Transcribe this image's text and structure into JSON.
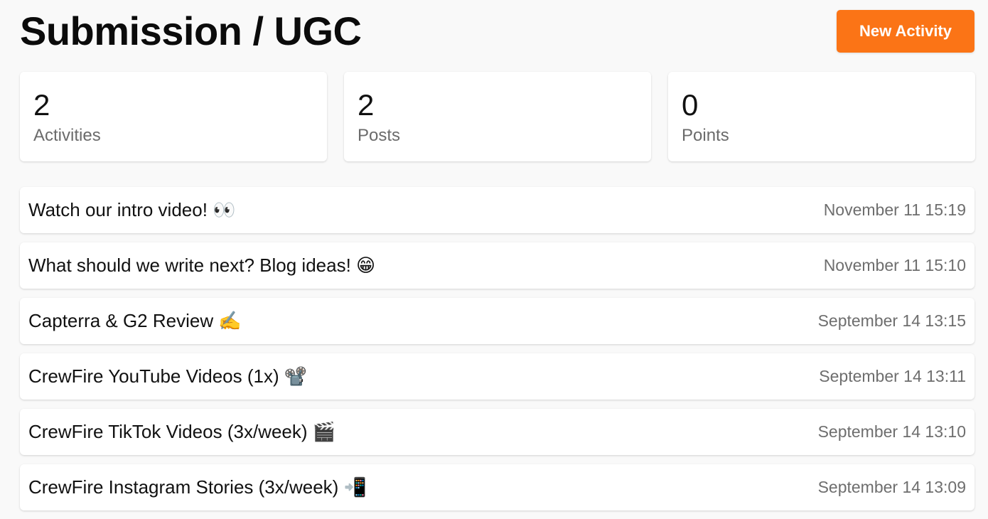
{
  "header": {
    "title": "Submission / UGC",
    "new_activity_label": "New Activity",
    "accent_color": "#fb7416"
  },
  "stats": [
    {
      "value": "2",
      "label": "Activities"
    },
    {
      "value": "2",
      "label": "Posts"
    },
    {
      "value": "0",
      "label": "Points"
    }
  ],
  "activities": [
    {
      "title": "Watch our intro video! 👀",
      "date": "November 11 15:19"
    },
    {
      "title": "What should we write next? Blog ideas! 😁",
      "date": "November 11 15:10"
    },
    {
      "title": "Capterra & G2 Review ✍️",
      "date": "September 14 13:15"
    },
    {
      "title": "CrewFire YouTube Videos (1x) 📽️",
      "date": "September 14 13:11"
    },
    {
      "title": "CrewFire TikTok Videos (3x/week) 🎬",
      "date": "September 14 13:10"
    },
    {
      "title": "CrewFire Instagram Stories (3x/week) 📲",
      "date": "September 14 13:09"
    }
  ]
}
